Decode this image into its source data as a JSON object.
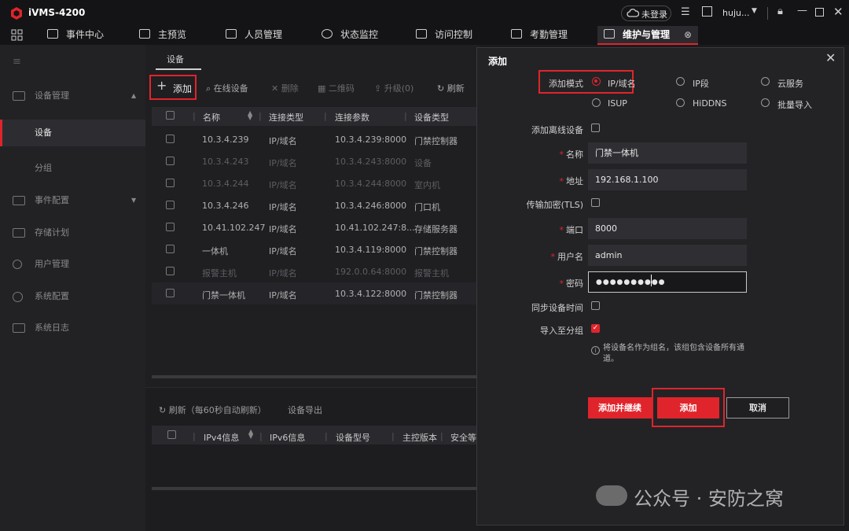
{
  "app": {
    "title": "iVMS-4200",
    "login_status": "未登录",
    "username": "huju..."
  },
  "nav": {
    "tabs": [
      "事件中心",
      "主预览",
      "人员管理",
      "状态监控",
      "访问控制",
      "考勤管理",
      "维护与管理"
    ]
  },
  "sidebar": {
    "items": [
      {
        "label": "设备管理",
        "icon": "device-manage-icon"
      },
      {
        "label": "设备"
      },
      {
        "label": "分组"
      },
      {
        "label": "事件配置",
        "icon": "event-config-icon"
      },
      {
        "label": "存储计划",
        "icon": "storage-icon"
      },
      {
        "label": "用户管理",
        "icon": "user-icon"
      },
      {
        "label": "系统配置",
        "icon": "gear-icon"
      },
      {
        "label": "系统日志",
        "icon": "log-icon"
      }
    ]
  },
  "main": {
    "tab": "设备",
    "toolbar": {
      "add": "添加",
      "online": "在线设备",
      "delete": "删除",
      "qrcode": "二维码",
      "upgrade": "升级(0)",
      "refresh": "刷新"
    },
    "columns": [
      "名称",
      "连接类型",
      "连接参数",
      "设备类型"
    ],
    "rows": [
      {
        "name": "10.3.4.239",
        "conn": "IP/域名",
        "param": "10.3.4.239:8000",
        "type": "门禁控制器",
        "dim": false
      },
      {
        "name": "10.3.4.243",
        "conn": "IP/域名",
        "param": "10.3.4.243:8000",
        "type": "设备",
        "dim": true
      },
      {
        "name": "10.3.4.244",
        "conn": "IP/域名",
        "param": "10.3.4.244:8000",
        "type": "室内机",
        "dim": true
      },
      {
        "name": "10.3.4.246",
        "conn": "IP/域名",
        "param": "10.3.4.246:8000",
        "type": "门口机",
        "dim": false
      },
      {
        "name": "10.41.102.247",
        "conn": "IP/域名",
        "param": "10.41.102.247:8...",
        "type": "存储服务器",
        "dim": false
      },
      {
        "name": "一体机",
        "conn": "IP/域名",
        "param": "10.3.4.119:8000",
        "type": "门禁控制器",
        "dim": false
      },
      {
        "name": "报警主机",
        "conn": "IP/域名",
        "param": "192.0.0.64:8000",
        "type": "报警主机",
        "dim": true
      },
      {
        "name": "门禁一体机",
        "conn": "IP/域名",
        "param": "10.3.4.122:8000",
        "type": "门禁控制器",
        "dim": false
      }
    ],
    "bottom": {
      "refresh": "刷新（每60秒自动刷新）",
      "export": "设备导出",
      "columns": [
        "IPv4信息",
        "IPv6信息",
        "设备型号",
        "主控版本",
        "安全等级"
      ]
    }
  },
  "dialog": {
    "title": "添加",
    "add_mode_label": "添加模式",
    "modes": [
      "IP/域名",
      "IP段",
      "云服务",
      "ISUP",
      "HiDDNS",
      "批量导入"
    ],
    "selected_mode": "IP/域名",
    "offline_label": "添加离线设备",
    "name_label": "名称",
    "name_value": "门禁一体机",
    "address_label": "地址",
    "address_value": "192.168.1.100",
    "tls_label": "传输加密(TLS)",
    "port_label": "端口",
    "port_value": "8000",
    "user_label": "用户名",
    "user_value": "admin",
    "password_label": "密码",
    "password_value": "●●●●●●●●●●",
    "sync_label": "同步设备时间",
    "import_label": "导入至分组",
    "hint": "将设备名作为组名，该组包含设备所有通道。",
    "btn_add_continue": "添加并继续",
    "btn_add": "添加",
    "btn_cancel": "取消"
  },
  "watermark": "公众号 · 安防之窝",
  "colors": {
    "accent": "#e0242b",
    "bg": "#1b1b1d"
  }
}
